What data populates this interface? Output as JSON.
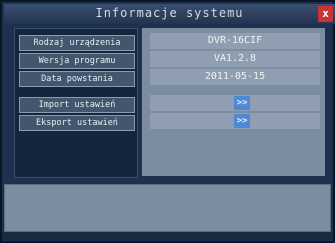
{
  "window": {
    "title": "Informacje systemu",
    "close_label": "x"
  },
  "info": {
    "rows": [
      {
        "label": "Rodzaj urządzenia",
        "value": "DVR-16CIF"
      },
      {
        "label": "Wersja programu",
        "value": "VA1.2.8"
      },
      {
        "label": "Data powstania",
        "value": "2011-05-15"
      }
    ]
  },
  "actions": {
    "import_label": "Import ustawień",
    "export_label": "Eksport ustawień",
    "arrow_glyph": ">>"
  },
  "status": {
    "text": ""
  },
  "colors": {
    "close": "#c83434",
    "arrow_button": "#4e8ad2",
    "panel": "#7c8da0"
  }
}
